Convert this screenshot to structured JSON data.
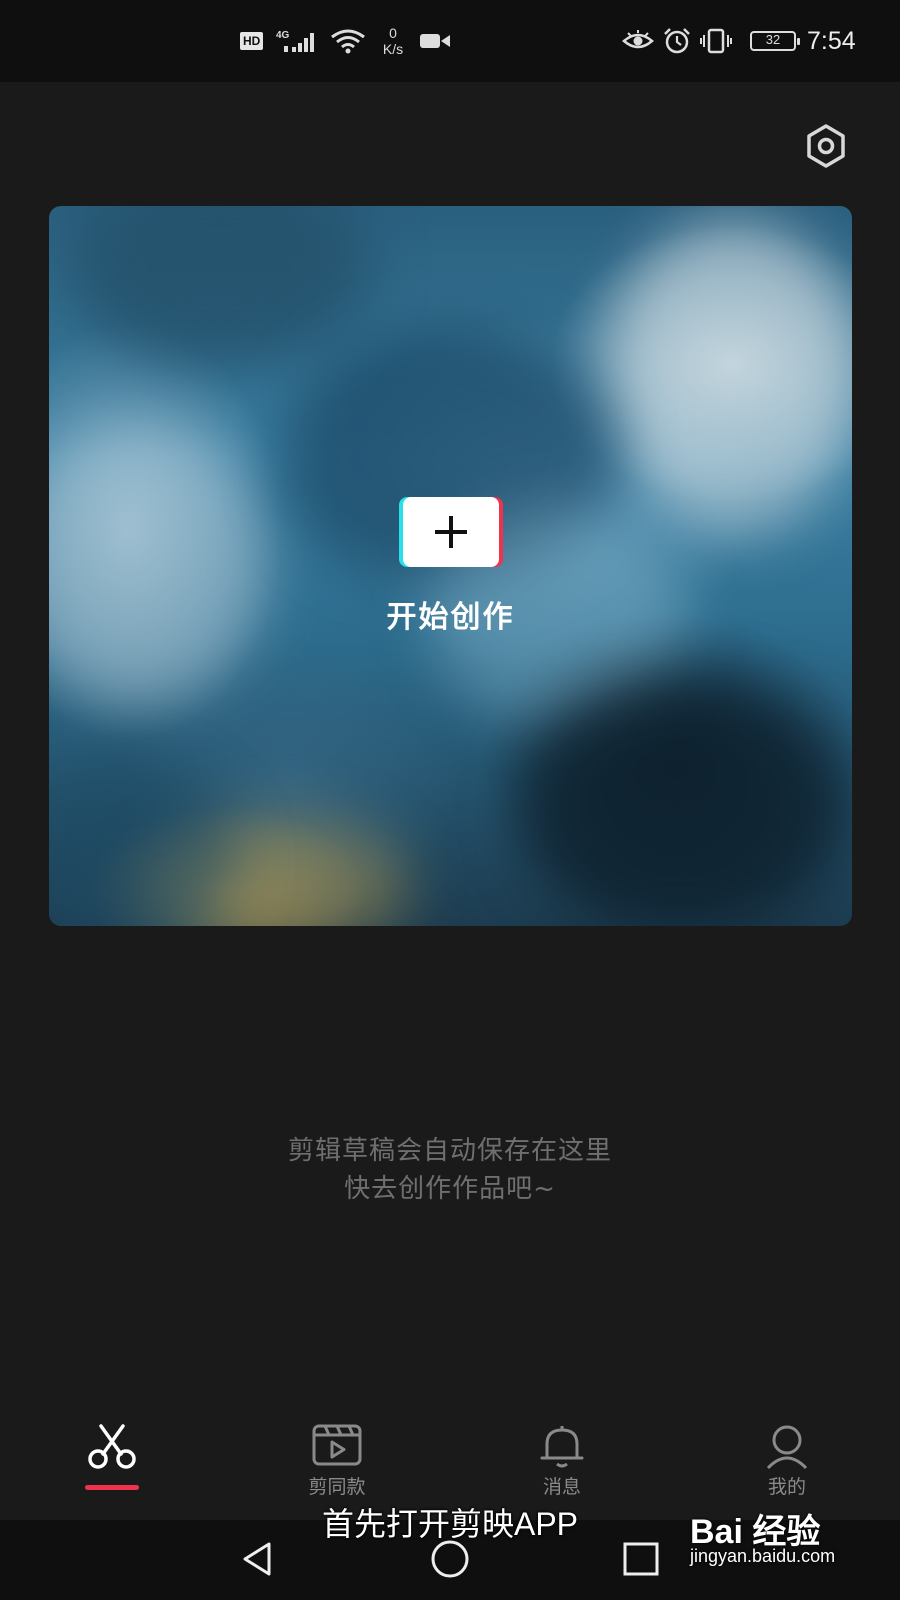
{
  "status_bar": {
    "hd": "HD",
    "network": "4G",
    "speed_value": "0",
    "speed_unit": "K/s",
    "battery": "32",
    "time": "7:54"
  },
  "hero": {
    "create_label": "开始创作"
  },
  "empty_state": {
    "line1": "剪辑草稿会自动保存在这里",
    "line2": "快去创作作品吧~"
  },
  "tabs": [
    {
      "label": "",
      "icon": "scissors-icon",
      "active": true
    },
    {
      "label": "剪同款",
      "icon": "clapperboard-icon",
      "active": false
    },
    {
      "label": "消息",
      "icon": "bell-icon",
      "active": false
    },
    {
      "label": "我的",
      "icon": "person-icon",
      "active": false
    }
  ],
  "caption": "首先打开剪映APP",
  "watermark": {
    "logo": "Bai 经验",
    "url": "jingyan.baidu.com"
  },
  "colors": {
    "background": "#1a1a1a",
    "accent": "#f0334d",
    "accent_cyan": "#27e0e8",
    "muted_text": "#6f6f6f"
  }
}
